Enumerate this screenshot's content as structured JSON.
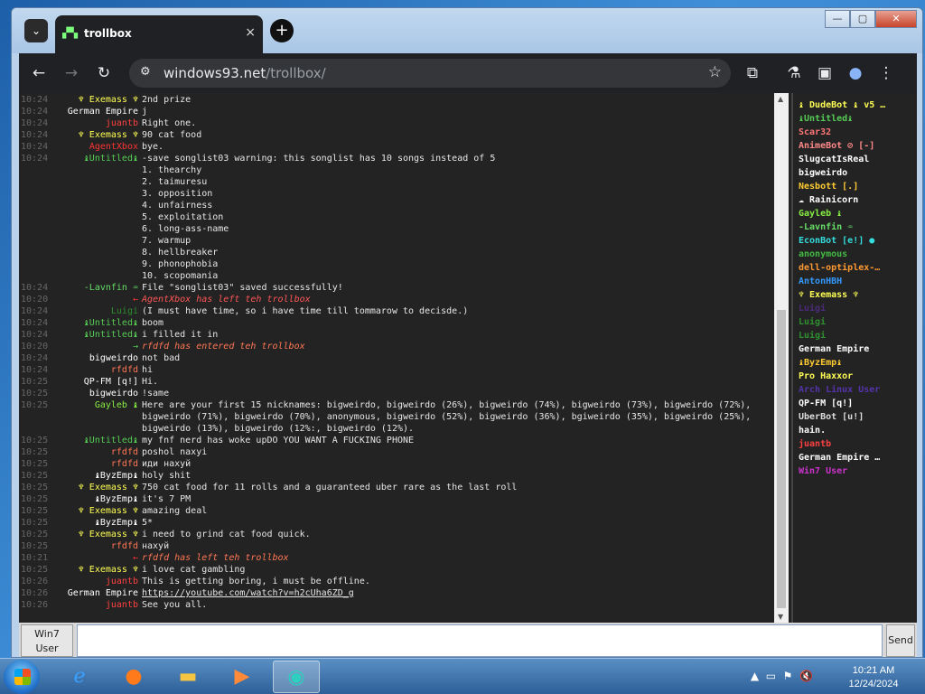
{
  "browser": {
    "tab_title": "trollbox",
    "tab_close": "×",
    "tab_dropdown": "⌄",
    "new_tab": "+",
    "url_host": "windows93.net",
    "url_path": "/trollbox/",
    "window_buttons": {
      "minimize": "—",
      "maximize": "▢",
      "close": "✕"
    }
  },
  "chat": {
    "messages": [
      {
        "time": "10:24",
        "nick": "♆ Exemass ♆",
        "nick_color": "#ffff55",
        "text": "2nd prize"
      },
      {
        "time": "10:24",
        "nick": "German Empire",
        "nick_color": "#ffffff",
        "text": "j"
      },
      {
        "time": "10:24",
        "nick": "juantb",
        "nick_color": "#ff4040",
        "text": "Right one."
      },
      {
        "time": "10:24",
        "nick": "♆ Exemass ♆",
        "nick_color": "#ffff55",
        "text": "90 cat food"
      },
      {
        "time": "10:24",
        "nick": "AgentXbox",
        "nick_color": "#ff3333",
        "text": "bye."
      },
      {
        "time": "10:24",
        "nick": "♝Untitled♝",
        "nick_color": "#55cc55",
        "text": "-save songlist03 warning: this songlist has 10 songs instead of 5"
      },
      {
        "time": "",
        "nick": "",
        "nick_color": "#ffffff",
        "text": "1. thearchy"
      },
      {
        "time": "",
        "nick": "",
        "nick_color": "#ffffff",
        "text": "2. taimuresu"
      },
      {
        "time": "",
        "nick": "",
        "nick_color": "#ffffff",
        "text": "3. opposition"
      },
      {
        "time": "",
        "nick": "",
        "nick_color": "#ffffff",
        "text": "4. unfairness"
      },
      {
        "time": "",
        "nick": "",
        "nick_color": "#ffffff",
        "text": "5. exploitation"
      },
      {
        "time": "",
        "nick": "",
        "nick_color": "#ffffff",
        "text": "6. long-ass-name"
      },
      {
        "time": "",
        "nick": "",
        "nick_color": "#ffffff",
        "text": "7. warmup"
      },
      {
        "time": "",
        "nick": "",
        "nick_color": "#ffffff",
        "text": "8. hellbreaker"
      },
      {
        "time": "",
        "nick": "",
        "nick_color": "#ffffff",
        "text": "9. phonophobia"
      },
      {
        "time": "",
        "nick": "",
        "nick_color": "#ffffff",
        "text": "10. scopomania"
      },
      {
        "time": "10:24",
        "nick": "-Lavnfin ♒",
        "nick_color": "#66dd66",
        "text": "File \"songlist03\" saved successfully!"
      },
      {
        "time": "10:20",
        "nick": "←",
        "nick_color": "#ff3333",
        "text": "AgentXbox has left teh trollbox",
        "sys": true,
        "text_color": "#ff5555"
      },
      {
        "time": "10:24",
        "nick": "Luigi",
        "nick_color": "#2f8f2f",
        "text": "(I must have time, so i have time till tommarow to decisde.)"
      },
      {
        "time": "10:24",
        "nick": "♝Untitled♝",
        "nick_color": "#55cc55",
        "text": "boom"
      },
      {
        "time": "10:24",
        "nick": "♝Untitled♝",
        "nick_color": "#55cc55",
        "text": "i filled it in"
      },
      {
        "time": "10:20",
        "nick": "→",
        "nick_color": "#55cc55",
        "text": "rfdfd has entered teh trollbox",
        "sys": true,
        "text_color": "#ff7755"
      },
      {
        "time": "10:24",
        "nick": "bigweirdo",
        "nick_color": "#ffffff",
        "text": "not bad"
      },
      {
        "time": "10:24",
        "nick": "rfdfd",
        "nick_color": "#ff7755",
        "text": "hi"
      },
      {
        "time": "10:25",
        "nick": "QP-FM [q!]",
        "nick_color": "#ffffff",
        "text": "Hi."
      },
      {
        "time": "10:25",
        "nick": "bigweirdo",
        "nick_color": "#ffffff",
        "text": "!same"
      },
      {
        "time": "10:25",
        "nick": "Gayleb ♝",
        "nick_color": "#88ee44",
        "text": "Here are your first 15 nicknames: bigweirdo, bigweirdo (26%), bigweirdo (74%), bigweirdo (73%), bigweirdo (72%),"
      },
      {
        "time": "",
        "nick": "",
        "nick_color": "#ffffff",
        "text": "bigweirdo (71%), bigweirdo (70%), anonymous, bigweirdo (52%), bigweirdo (36%), bgiweirdo (35%), bigweirdo (25%),"
      },
      {
        "time": "",
        "nick": "",
        "nick_color": "#ffffff",
        "text": "bigweirdo (13%), bigweirdo (12%:, bigweirdo (12%)."
      },
      {
        "time": "10:25",
        "nick": "♝Untitled♝",
        "nick_color": "#55cc55",
        "text": "my fnf nerd has woke upDO YOU WANT A FUCKING PHONE"
      },
      {
        "time": "10:25",
        "nick": "rfdfd",
        "nick_color": "#ff7755",
        "text": "poshol naxyi"
      },
      {
        "time": "10:25",
        "nick": "rfdfd",
        "nick_color": "#ff7755",
        "text": "иди нахуй"
      },
      {
        "time": "10:25",
        "nick": "♝ByzEmp♝",
        "nick_color": "#ffffff",
        "text": "holy shit"
      },
      {
        "time": "10:25",
        "nick": "♆ Exemass ♆",
        "nick_color": "#ffff55",
        "text": "750 cat food for 11 rolls and a guaranteed uber rare as the last roll"
      },
      {
        "time": "10:25",
        "nick": "♝ByzEmp♝",
        "nick_color": "#ffffff",
        "text": "it's 7 PM"
      },
      {
        "time": "10:25",
        "nick": "♆ Exemass ♆",
        "nick_color": "#ffff55",
        "text": "amazing deal"
      },
      {
        "time": "10:25",
        "nick": "♝ByzEmp♝",
        "nick_color": "#ffffff",
        "text": "5*"
      },
      {
        "time": "10:25",
        "nick": "♆ Exemass ♆",
        "nick_color": "#ffff55",
        "text": "i need to grind cat food quick."
      },
      {
        "time": "10:25",
        "nick": "rfdfd",
        "nick_color": "#ff7755",
        "text": "нахуй"
      },
      {
        "time": "10:21",
        "nick": "←",
        "nick_color": "#ff3333",
        "text": "rfdfd has left teh trollbox",
        "sys": true,
        "text_color": "#ff7755"
      },
      {
        "time": "10:25",
        "nick": "♆ Exemass ♆",
        "nick_color": "#ffff55",
        "text": "i love cat gambling"
      },
      {
        "time": "10:26",
        "nick": "juantb",
        "nick_color": "#ff4040",
        "text": "This is getting boring, i must be offline."
      },
      {
        "time": "10:26",
        "nick": "German Empire",
        "nick_color": "#ffffff",
        "text": "https://youtube.com/watch?v=h2cUha6ZD_g",
        "link": true
      },
      {
        "time": "10:26",
        "nick": "juantb",
        "nick_color": "#ff4040",
        "text": "See you all."
      }
    ]
  },
  "users": [
    {
      "name": "♝ DudeBot ♝ v5 …",
      "color": "#ffff55"
    },
    {
      "name": "♝Untitled♝",
      "color": "#55cc55"
    },
    {
      "name": "Scar32",
      "color": "#ff7777"
    },
    {
      "name": "AnimeBot ⊘ [-]",
      "color": "#ff8888"
    },
    {
      "name": "SlugcatIsReal",
      "color": "#ffffff"
    },
    {
      "name": "bigweirdo",
      "color": "#ffffff"
    },
    {
      "name": "Nesbott [.]",
      "color": "#ffcc33"
    },
    {
      "name": "☁ Rainicorn",
      "color": "#ffffff"
    },
    {
      "name": "Gayleb ♝",
      "color": "#88ee44"
    },
    {
      "name": "-Lavnfin ♒",
      "color": "#66dd66"
    },
    {
      "name": "EconBot [e!] ●",
      "color": "#33dddd"
    },
    {
      "name": "anonymous",
      "color": "#44bb44"
    },
    {
      "name": "dell-optiplex-…",
      "color": "#ff9933"
    },
    {
      "name": "AntonHBH",
      "color": "#3399ff"
    },
    {
      "name": "♆ Exemass ♆",
      "color": "#ffff55"
    },
    {
      "name": "Luigi",
      "color": "#4b2a7a"
    },
    {
      "name": "Luigi",
      "color": "#2f8f2f"
    },
    {
      "name": "Luigi",
      "color": "#2f8f2f"
    },
    {
      "name": "German Empire",
      "color": "#ffffff"
    },
    {
      "name": "♝ByzEmp♝",
      "color": "#ffcc33"
    },
    {
      "name": "Pro Haxxor",
      "color": "#ffff55"
    },
    {
      "name": "Arch Linux User",
      "color": "#5533aa"
    },
    {
      "name": "QP-FM [q!]",
      "color": "#ffffff"
    },
    {
      "name": "UberBot [u!]",
      "color": "#dddddd"
    },
    {
      "name": "hain.",
      "color": "#ffffff"
    },
    {
      "name": "juantb",
      "color": "#ff4040"
    },
    {
      "name": "German Empire …",
      "color": "#ffffff"
    },
    {
      "name": "Win7 User",
      "color": "#cc33cc"
    }
  ],
  "input": {
    "user_label_1": "Win7",
    "user_label_2": "User",
    "message_value": "",
    "send_label": "Send"
  },
  "taskbar": {
    "time": "10:21 AM",
    "date": "12/24/2024"
  }
}
